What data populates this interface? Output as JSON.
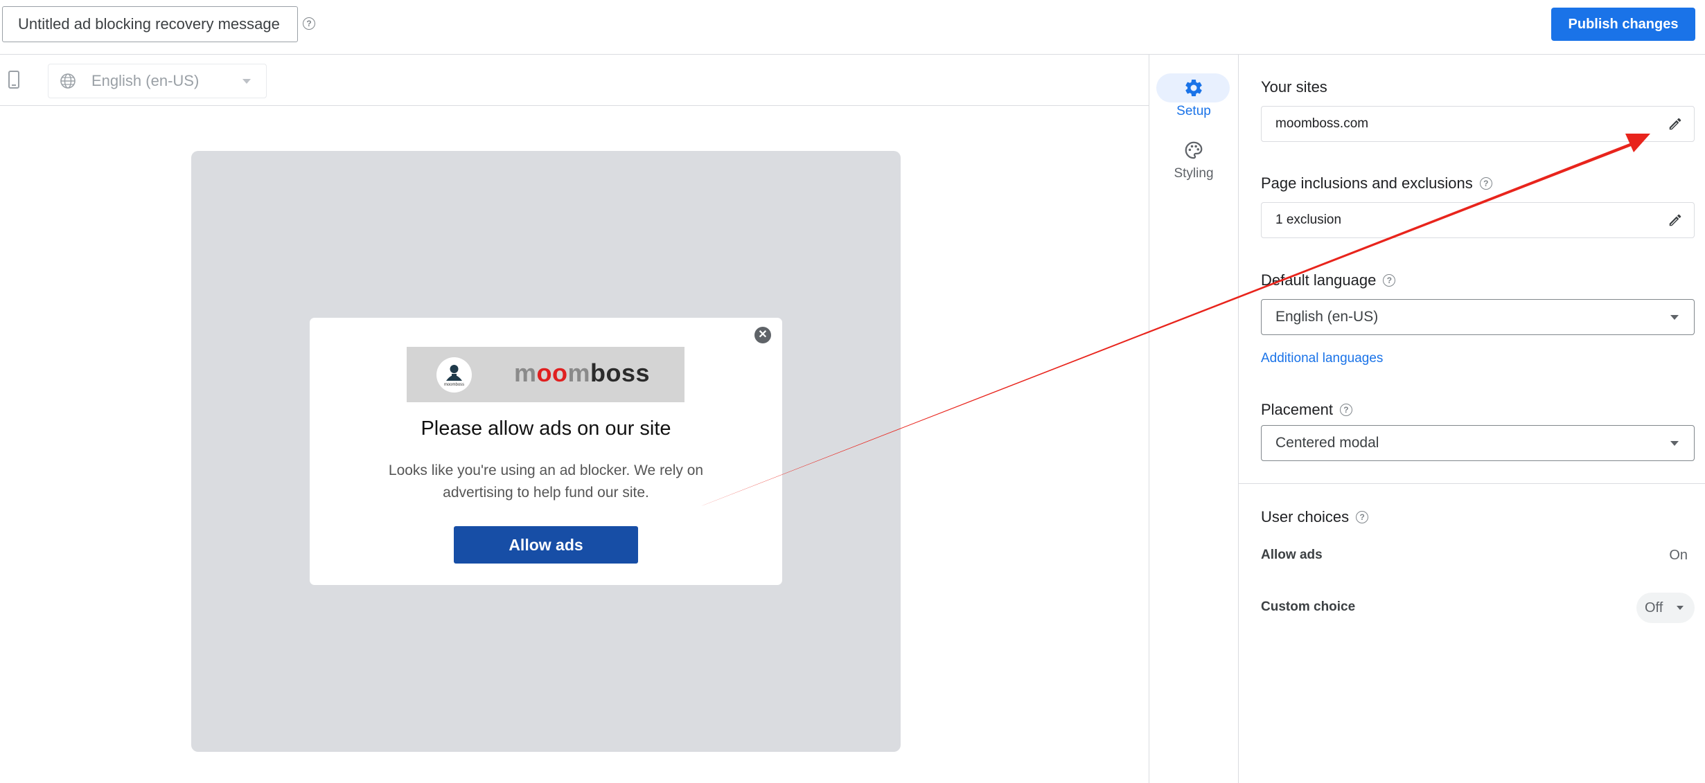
{
  "header": {
    "title_value": "Untitled ad blocking recovery message",
    "publish_label": "Publish changes"
  },
  "preview": {
    "language": "English (en-US)",
    "modal": {
      "logo_text_parts": [
        "m",
        "oo",
        "m",
        "boss"
      ],
      "logo_small_text": "moomboss",
      "title": "Please allow ads on our site",
      "body": "Looks like you're using an ad blocker. We rely on advertising to help fund our site.",
      "button_label": "Allow ads",
      "close_glyph": "✕"
    }
  },
  "nav": {
    "setup_label": "Setup",
    "styling_label": "Styling"
  },
  "panel": {
    "your_sites": {
      "title": "Your sites",
      "value": "moomboss.com"
    },
    "inclusions": {
      "title": "Page inclusions and exclusions",
      "value": "1 exclusion"
    },
    "default_language": {
      "title": "Default language",
      "value": "English (en-US)"
    },
    "additional_languages_link": "Additional languages",
    "placement": {
      "title": "Placement",
      "value": "Centered modal"
    },
    "user_choices": {
      "title": "User choices",
      "allow_ads": {
        "label": "Allow ads",
        "value": "On"
      },
      "custom_choice": {
        "label": "Custom choice",
        "value": "Off"
      }
    }
  },
  "help_glyph": "?",
  "colors": {
    "accent": "#1a73e8",
    "annotation_arrow": "#e8241c",
    "allow_ads_button": "#174ea6",
    "logo_red": "#e02020",
    "logo_gray": "#8a8a8a",
    "logo_dark": "#2b2b2b"
  }
}
